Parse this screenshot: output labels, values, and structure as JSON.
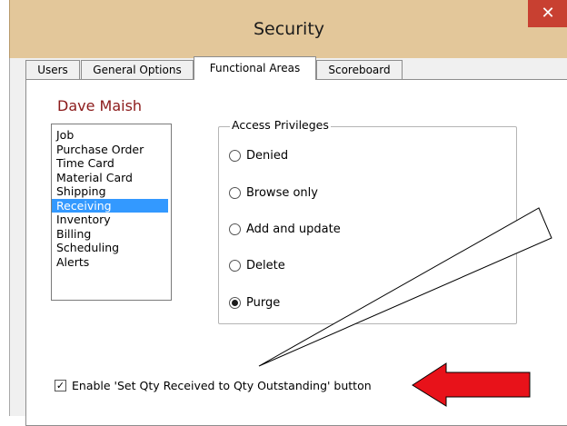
{
  "window": {
    "title": "Security",
    "close_icon": "close-icon"
  },
  "tabs": [
    {
      "label": "Users",
      "active": false
    },
    {
      "label": "General Options",
      "active": false
    },
    {
      "label": "Functional Areas",
      "active": true
    },
    {
      "label": "Scoreboard",
      "active": false
    }
  ],
  "user_name": "Dave Maish",
  "functional_areas": {
    "items": [
      "Job",
      "Purchase Order",
      "Time Card",
      "Material Card",
      "Shipping",
      "Receiving",
      "Inventory",
      "Billing",
      "Scheduling",
      "Alerts"
    ],
    "selected": "Receiving"
  },
  "access_privileges": {
    "legend": "Access Privileges",
    "options": [
      "Denied",
      "Browse only",
      "Add and update",
      "Delete",
      "Purge"
    ],
    "selected": "Purge"
  },
  "enable_checkbox": {
    "label": "Enable 'Set Qty Received to Qty Outstanding' button",
    "checked": true
  },
  "colors": {
    "title_bar": "#e3c79a",
    "close_button": "#c84031",
    "selection": "#3399ff",
    "user_name": "#8b1a1a",
    "callout_arrow": "#e8121a"
  }
}
